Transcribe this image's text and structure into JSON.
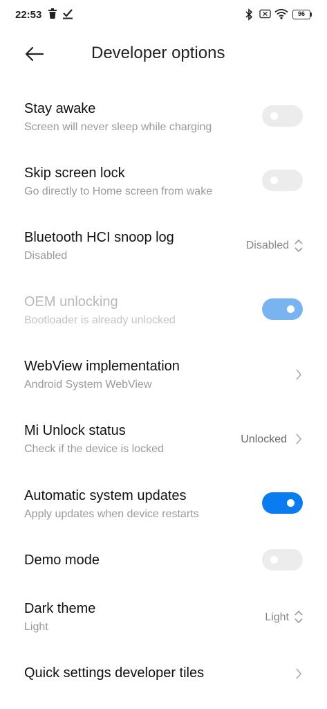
{
  "status_bar": {
    "time": "22:53",
    "battery": "96",
    "icons": [
      "trash-icon",
      "download-done-icon",
      "bluetooth-icon",
      "no-sim-icon",
      "wifi-icon",
      "battery-icon"
    ]
  },
  "header": {
    "title": "Developer options",
    "back_icon": "arrow-left-icon"
  },
  "settings": [
    {
      "title": "Stay awake",
      "subtitle": "Screen will never sleep while charging",
      "control": "toggle",
      "state": "off"
    },
    {
      "title": "Skip screen lock",
      "subtitle": "Go directly to Home screen from wake",
      "control": "toggle",
      "state": "off"
    },
    {
      "title": "Bluetooth HCI snoop log",
      "subtitle": "Disabled",
      "control": "select",
      "value": "Disabled"
    },
    {
      "title": "OEM unlocking",
      "subtitle": "Bootloader is already unlocked",
      "control": "toggle",
      "state": "on",
      "enabled": false
    },
    {
      "title": "WebView implementation",
      "subtitle": "Android System WebView",
      "control": "chevron"
    },
    {
      "title": "Mi Unlock status",
      "subtitle": "Check if the device is locked",
      "control": "chevron",
      "value": "Unlocked"
    },
    {
      "title": "Automatic system updates",
      "subtitle": "Apply updates when device restarts",
      "control": "toggle",
      "state": "on"
    },
    {
      "title": "Demo mode",
      "control": "toggle",
      "state": "off"
    },
    {
      "title": "Dark theme",
      "subtitle": "Light",
      "control": "select",
      "value": "Light"
    },
    {
      "title": "Quick settings developer tiles",
      "control": "chevron"
    }
  ],
  "colors": {
    "accent": "#0a7cf0",
    "accent_disabled": "#79b4f1",
    "toggle_off": "#ececec",
    "subtitle": "#9a9a9a"
  }
}
